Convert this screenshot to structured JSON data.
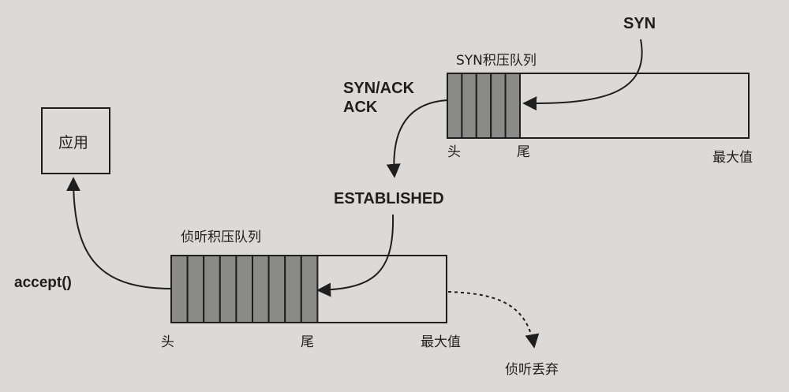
{
  "labels": {
    "syn": "SYN",
    "syn_queue_title": "SYN积压队列",
    "synack": "SYN/ACK",
    "ack": "ACK",
    "syn_head": "头",
    "syn_tail": "尾",
    "syn_max": "最大值",
    "established": "ESTABLISHED",
    "app": "应用",
    "listen_queue_title": "侦听积压队列",
    "accept": "accept()",
    "listen_head": "头",
    "listen_tail": "尾",
    "listen_max": "最大值",
    "listen_drop": "侦听丢弃"
  },
  "syn_queue": {
    "filled_slots": 5
  },
  "listen_queue": {
    "filled_slots": 9
  },
  "colors": {
    "slot_fill": "#8a8a88",
    "line": "#1e1e1e",
    "background": "#dcd9d6"
  }
}
